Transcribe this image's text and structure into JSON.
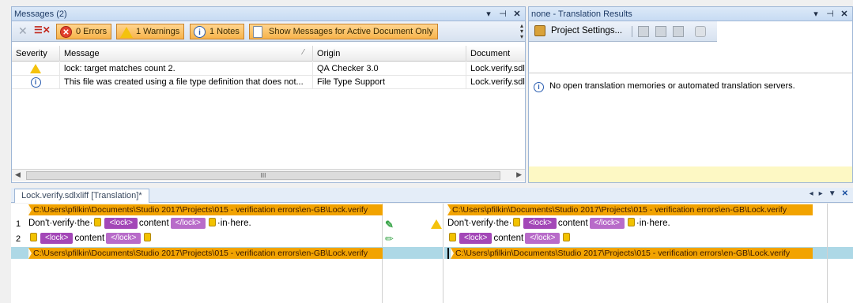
{
  "messages_panel": {
    "title": "Messages (2)",
    "buttons": {
      "errors": "0 Errors",
      "warnings": "1 Warnings",
      "notes": "1 Notes",
      "show_active": "Show Messages for Active Document Only"
    },
    "columns": [
      "Severity",
      "Message",
      "Origin",
      "Document"
    ],
    "rows": [
      {
        "severity": "warning",
        "message": "lock: target matches count 2.",
        "origin": "QA Checker 3.0",
        "document": "Lock.verify.sdl"
      },
      {
        "severity": "info",
        "message": "This file was created using a file type definition that does not...",
        "origin": "File Type Support",
        "document": "Lock.verify.sdl"
      }
    ],
    "scroll_glyph": "III"
  },
  "translation_panel": {
    "title": "none - Translation Results",
    "project_settings_label": "Project Settings...",
    "info_message": "No open translation memories or automated translation servers."
  },
  "editor": {
    "tab_label": "Lock.verify.sdlxliff [Translation]*",
    "source_path": "C:\\Users\\pfilkin\\Documents\\Studio 2017\\Projects\\015 - verification errors\\en-GB\\Lock.verify",
    "target_path": "C:\\Users\\pfilkin\\Documents\\Studio 2017\\Projects\\015 - verification errors\\en-GB\\Lock.verify",
    "segments": [
      {
        "num": "1",
        "parts_before": "Don't·verify·the·",
        "tag_open": "<lock>",
        "content": "content",
        "tag_close": "</lock>",
        "parts_after": "·in·here."
      },
      {
        "num": "2",
        "tag_open": "<lock>",
        "content": "content",
        "tag_close": "</lock>"
      }
    ]
  }
}
